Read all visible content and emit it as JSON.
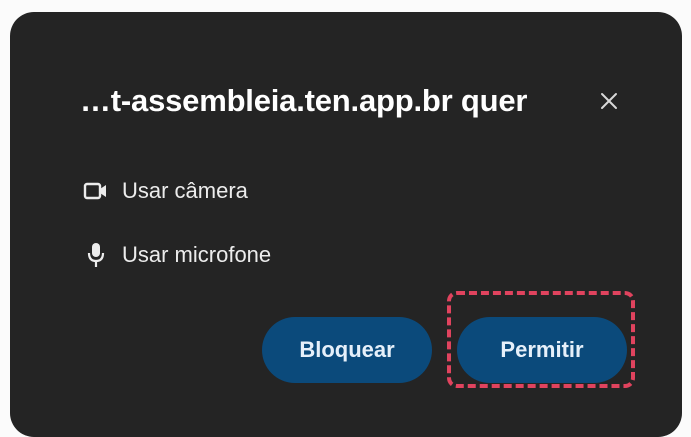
{
  "dialog": {
    "title": "…t-assembleia.ten.app.br quer",
    "close_icon": "close-icon",
    "permissions": [
      {
        "icon": "camera-icon",
        "label": "Usar câmera"
      },
      {
        "icon": "microphone-icon",
        "label": "Usar microfone"
      }
    ],
    "buttons": {
      "block_label": "Bloquear",
      "allow_label": "Permitir"
    }
  },
  "colors": {
    "dialog_bg": "#242424",
    "button_bg": "#0b4a7b",
    "highlight": "#e0435e"
  }
}
